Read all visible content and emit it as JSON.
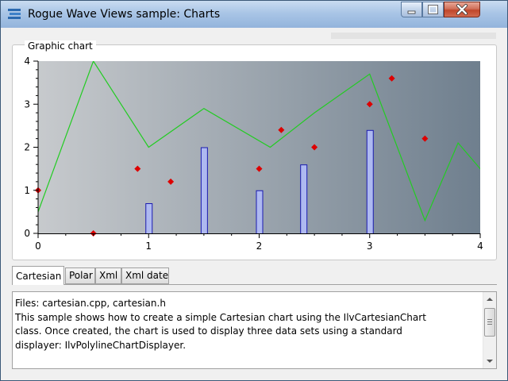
{
  "window": {
    "title": "Rogue Wave Views sample: Charts"
  },
  "group": {
    "label": "Graphic chart"
  },
  "chart_data": {
    "type": "line",
    "x_ticks": [
      "0",
      "1",
      "2",
      "3",
      "4"
    ],
    "y_ticks": [
      "0",
      "1",
      "2",
      "3",
      "4"
    ],
    "xlim": [
      0,
      4
    ],
    "ylim": [
      0,
      4
    ],
    "series": [
      {
        "kind": "line",
        "color": "#22cc22",
        "x": [
          0,
          0.5,
          1.0,
          1.5,
          2.1,
          2.5,
          3.0,
          3.5,
          3.8,
          4.2
        ],
        "y": [
          0.5,
          4.0,
          2.0,
          2.9,
          2.0,
          2.8,
          3.7,
          0.3,
          2.1,
          0.9
        ]
      },
      {
        "kind": "scatter",
        "color": "#dd0000",
        "x": [
          0,
          0.5,
          0.9,
          1.2,
          2.0,
          2.2,
          2.5,
          3.0,
          3.2,
          3.5
        ],
        "y": [
          1.0,
          0.0,
          1.5,
          1.2,
          1.5,
          2.4,
          2.0,
          3.0,
          3.6,
          2.2
        ]
      },
      {
        "kind": "bar",
        "color": "#aeb9f0",
        "stroke": "#1a1ab0",
        "x": [
          1.0,
          1.5,
          2.0,
          2.4,
          3.0
        ],
        "y": [
          0.7,
          2.0,
          1.0,
          1.6,
          2.4
        ]
      }
    ]
  },
  "tabs": [
    {
      "label": "Cartesian",
      "active": true
    },
    {
      "label": "Polar",
      "active": false
    },
    {
      "label": "Xml",
      "active": false
    },
    {
      "label": "Xml date",
      "active": false
    }
  ],
  "description": {
    "text": "Files: cartesian.cpp, cartesian.h\nThis sample shows how to create a simple Cartesian chart using the IlvCartesianChart\nclass. Once created, the chart is used to display three data sets using a standard\ndisplayer: IlvPolylineChartDisplayer."
  }
}
